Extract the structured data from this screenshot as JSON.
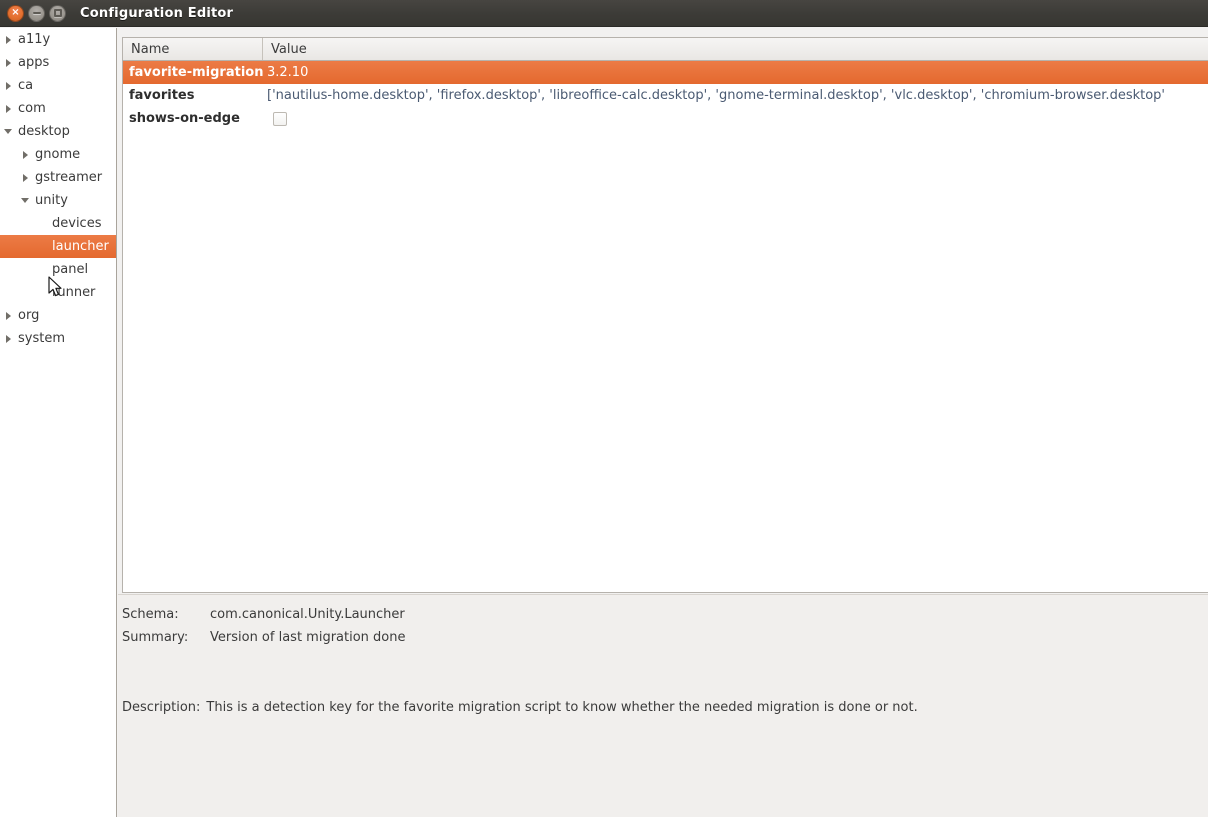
{
  "window": {
    "title": "Configuration Editor",
    "controls": [
      {
        "name": "close",
        "icon": "close-icon",
        "glyph": "×"
      },
      {
        "name": "minimize",
        "icon": "minimize-icon",
        "glyph": ""
      },
      {
        "name": "maximize",
        "icon": "maximize-icon",
        "glyph": ""
      }
    ]
  },
  "accent_color": "#e4692f",
  "sidebar": {
    "items": [
      {
        "label": "a11y",
        "level": 0,
        "twisty": "collapsed",
        "selected": false
      },
      {
        "label": "apps",
        "level": 0,
        "twisty": "collapsed",
        "selected": false
      },
      {
        "label": "ca",
        "level": 0,
        "twisty": "collapsed",
        "selected": false
      },
      {
        "label": "com",
        "level": 0,
        "twisty": "collapsed",
        "selected": false
      },
      {
        "label": "desktop",
        "level": 0,
        "twisty": "expanded",
        "selected": false
      },
      {
        "label": "gnome",
        "level": 1,
        "twisty": "collapsed",
        "selected": false
      },
      {
        "label": "gstreamer",
        "level": 1,
        "twisty": "collapsed",
        "selected": false
      },
      {
        "label": "unity",
        "level": 1,
        "twisty": "expanded",
        "selected": false
      },
      {
        "label": "devices",
        "level": 2,
        "twisty": "none",
        "selected": false
      },
      {
        "label": "launcher",
        "level": 2,
        "twisty": "none",
        "selected": true
      },
      {
        "label": "panel",
        "level": 2,
        "twisty": "none",
        "selected": false
      },
      {
        "label": "runner",
        "level": 2,
        "twisty": "none",
        "selected": false
      },
      {
        "label": "org",
        "level": 0,
        "twisty": "collapsed",
        "selected": false
      },
      {
        "label": "system",
        "level": 0,
        "twisty": "collapsed",
        "selected": false
      }
    ]
  },
  "table": {
    "columns": [
      {
        "label": "Name"
      },
      {
        "label": "Value"
      }
    ],
    "rows": [
      {
        "name": "favorite-migration",
        "value": "3.2.10",
        "type": "text",
        "selected": true
      },
      {
        "name": "favorites",
        "value": "['nautilus-home.desktop', 'firefox.desktop', 'libreoffice-calc.desktop', 'gnome-terminal.desktop', 'vlc.desktop', 'chromium-browser.desktop'",
        "type": "text",
        "selected": false
      },
      {
        "name": "shows-on-edge",
        "value": "",
        "type": "checkbox",
        "checked": false,
        "selected": false
      }
    ]
  },
  "info": {
    "schema_label": "Schema:",
    "schema_value": "com.canonical.Unity.Launcher",
    "summary_label": "Summary:",
    "summary_value": "Version of last migration done",
    "description_label": "Description:",
    "description_value": "This is a detection key for the favorite migration script to know whether the needed migration is done or not."
  }
}
